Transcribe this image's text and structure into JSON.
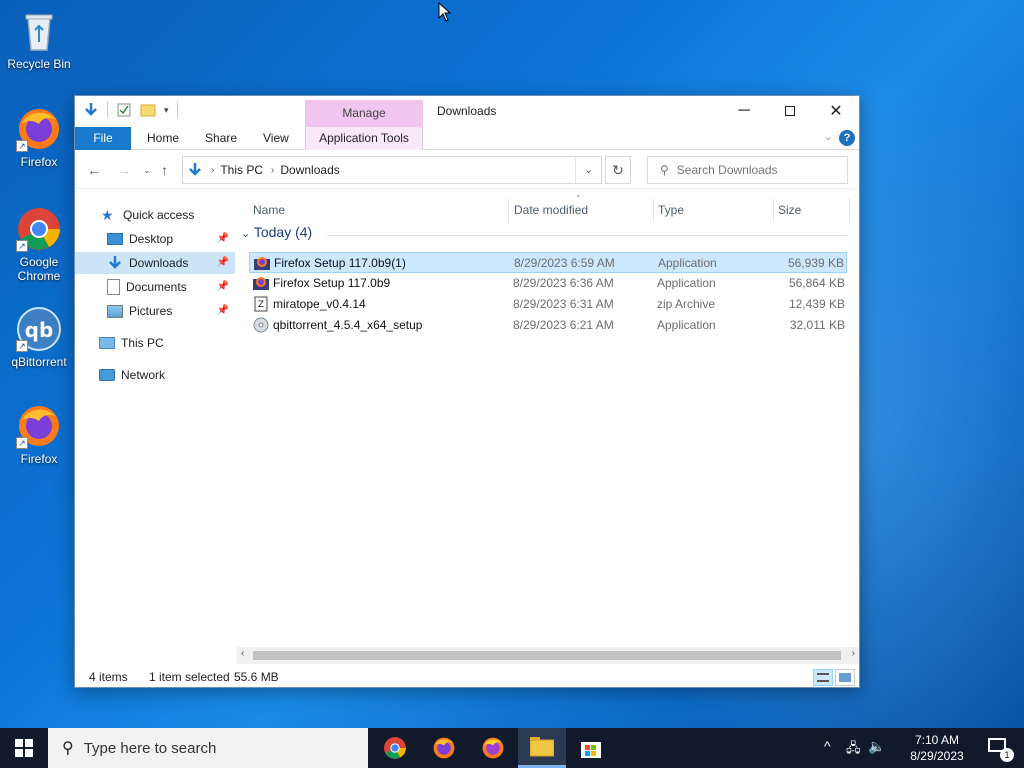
{
  "desktop": {
    "icons": [
      {
        "label": "Recycle Bin"
      },
      {
        "label": "Firefox"
      },
      {
        "label": "Google Chrome"
      },
      {
        "label": "qBittorrent"
      },
      {
        "label": "Firefox"
      }
    ]
  },
  "window": {
    "title": "Downloads",
    "manage_tab": "Manage",
    "ribbon_tabs": {
      "file": "File",
      "home": "Home",
      "share": "Share",
      "view": "View",
      "app_tools": "Application Tools"
    },
    "breadcrumb": {
      "root": "This PC",
      "current": "Downloads"
    },
    "search_placeholder": "Search Downloads",
    "nav": {
      "quick_access": "Quick access",
      "desktop": "Desktop",
      "downloads": "Downloads",
      "documents": "Documents",
      "pictures": "Pictures",
      "this_pc": "This PC",
      "network": "Network"
    },
    "columns": {
      "name": "Name",
      "date": "Date modified",
      "type": "Type",
      "size": "Size"
    },
    "group": "Today (4)",
    "files": [
      {
        "name": "Firefox Setup 117.0b9(1)",
        "date": "8/29/2023 6:59 AM",
        "type": "Application",
        "size": "56,939 KB",
        "icon": "firefox-installer-icon",
        "selected": true
      },
      {
        "name": "Firefox Setup 117.0b9",
        "date": "8/29/2023 6:36 AM",
        "type": "Application",
        "size": "56,864 KB",
        "icon": "firefox-installer-icon",
        "selected": false
      },
      {
        "name": "miratope_v0.4.14",
        "date": "8/29/2023 6:31 AM",
        "type": "zip Archive",
        "size": "12,439 KB",
        "icon": "zip-archive-icon",
        "selected": false
      },
      {
        "name": "qbittorrent_4.5.4_x64_setup",
        "date": "8/29/2023 6:21 AM",
        "type": "Application",
        "size": "32,011 KB",
        "icon": "setup-disc-icon",
        "selected": false
      }
    ],
    "status": {
      "count": "4 items",
      "selection": "1 item selected",
      "size": "55.6 MB"
    }
  },
  "taskbar": {
    "search_placeholder": "Type here to search",
    "time": "7:10 AM",
    "date": "8/29/2023",
    "notification_count": "1"
  },
  "colors": {
    "accent": "#1979ca",
    "selection": "#cce8ff",
    "manage": "#f0c6f0"
  }
}
